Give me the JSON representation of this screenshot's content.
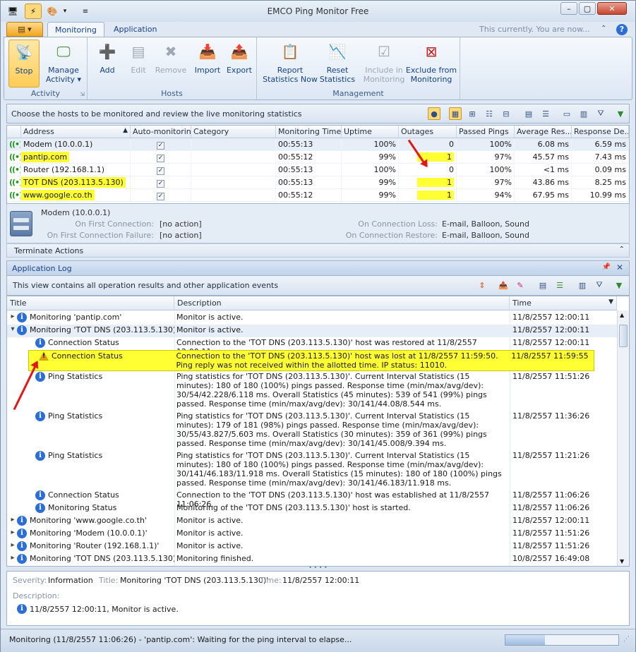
{
  "window": {
    "title": "EMCO Ping Monitor Free"
  },
  "qat_icons": [
    "app-icon",
    "toggle-icon",
    "chart-icon"
  ],
  "tabs": {
    "file": "",
    "monitoring": "Monitoring",
    "application": "Application"
  },
  "tab_right_text": "This currently. You are now...",
  "ribbon": {
    "activity": {
      "label": "Activity",
      "stop": "Stop",
      "manage": "Manage Activity ▾"
    },
    "hosts": {
      "label": "Hosts",
      "add": "Add",
      "edit": "Edit",
      "remove": "Remove",
      "import": "Import",
      "export": "Export"
    },
    "management": {
      "label": "Management",
      "report": "Report Statistics Now",
      "reset": "Reset Statistics",
      "include": "Include in Monitoring",
      "exclude": "Exclude from Monitoring"
    }
  },
  "hosts_panel": {
    "hint": "Choose the hosts to be monitored and review the live monitoring statistics"
  },
  "grid": {
    "columns": [
      "Address",
      "Auto-monitoring",
      "Category",
      "Monitoring Time",
      "Uptime",
      "Outages",
      "Passed Pings",
      "Average Res...",
      "Response De..."
    ],
    "rows": [
      {
        "address": "Modem (10.0.0.1)",
        "auto": "✓",
        "category": "",
        "time": "00:55:13",
        "uptime": "100%",
        "outages": "0",
        "passed": "100%",
        "avg": "6.08 ms",
        "dev": "6.59 ms"
      },
      {
        "address": "pantip.com",
        "auto": "✓",
        "category": "",
        "time": "00:55:12",
        "uptime": "99%",
        "outages": "1",
        "passed": "97%",
        "avg": "45.57 ms",
        "dev": "7.43 ms"
      },
      {
        "address": "Router (192.168.1.1)",
        "auto": "✓",
        "category": "",
        "time": "00:55:13",
        "uptime": "100%",
        "outages": "0",
        "passed": "100%",
        "avg": "<1 ms",
        "dev": "0.09 ms"
      },
      {
        "address": "TOT DNS (203.113.5.130)",
        "auto": "✓",
        "category": "",
        "time": "00:55:13",
        "uptime": "99%",
        "outages": "1",
        "passed": "97%",
        "avg": "43.86 ms",
        "dev": "8.25 ms"
      },
      {
        "address": "www.google.co.th",
        "auto": "✓",
        "category": "",
        "time": "00:55:12",
        "uptime": "99%",
        "outages": "1",
        "passed": "94%",
        "avg": "67.95 ms",
        "dev": "10.99 ms"
      }
    ]
  },
  "details": {
    "host": "Modem (10.0.0.1)",
    "first_connection_label": "On First Connection:",
    "first_connection": "[no action]",
    "first_failure_label": "On First Connection Failure:",
    "first_failure": "[no action]",
    "loss_label": "On Connection Loss:",
    "loss": "E-mail, Balloon, Sound",
    "restore_label": "On Connection Restore:",
    "restore": "E-mail, Balloon, Sound",
    "terminate": "Terminate Actions"
  },
  "log": {
    "title": "Application Log",
    "hint": "This view contains all operation results and other application events",
    "columns": [
      "Title",
      "Description",
      "Time"
    ],
    "rows": [
      {
        "title": "Monitoring 'pantip.com'",
        "desc": "Monitor is active.",
        "time": "11/8/2557 12:00:11"
      },
      {
        "title": "Monitoring 'TOT DNS (203.113.5.130)'",
        "desc": "Monitor is active.",
        "time": "11/8/2557 12:00:11"
      },
      {
        "title": "Connection Status",
        "desc": "Connection to the 'TOT DNS (203.113.5.130)' host was restored at 11/8/2557 12:00:11.",
        "time": "11/8/2557 12:00:11"
      },
      {
        "title": "Connection Status",
        "desc": "Connection to the 'TOT DNS (203.113.5.130)' host was lost at 11/8/2557 11:59:50. Ping reply was not received within the allotted time. IP status: 11010.",
        "time": "11/8/2557 11:59:55"
      },
      {
        "title": "Ping Statistics",
        "desc": "Ping statistics for 'TOT DNS (203.113.5.130)'. Current Interval Statistics (15 minutes): 180 of 180 (100%) pings passed. Response time (min/max/avg/dev): 30/54/42.228/6.118 ms. Overall Statistics (45 minutes): 539 of 541 (99%) pings passed. Response time (min/max/avg/dev): 30/141/44.08/8.544 ms.",
        "time": "11/8/2557 11:51:26"
      },
      {
        "title": "Ping Statistics",
        "desc": "Ping statistics for 'TOT DNS (203.113.5.130)'. Current Interval Statistics (15 minutes): 179 of 181 (98%) pings passed. Response time (min/max/avg/dev): 30/55/43.827/5.603 ms. Overall Statistics (30 minutes): 359 of 361 (99%) pings passed. Response time (min/max/avg/dev): 30/141/45.008/9.394 ms.",
        "time": "11/8/2557 11:36:26"
      },
      {
        "title": "Ping Statistics",
        "desc": "Ping statistics for 'TOT DNS (203.113.5.130)'. Current Interval Statistics (15 minutes): 180 of 180 (100%) pings passed. Response time (min/max/avg/dev): 30/141/46.183/11.918 ms. Overall Statistics (15 minutes): 180 of 180 (100%) pings passed. Response time (min/max/avg/dev): 30/141/46.183/11.918 ms.",
        "time": "11/8/2557 11:21:26"
      },
      {
        "title": "Connection Status",
        "desc": "Connection to the 'TOT DNS (203.113.5.130)' host was established at 11/8/2557 11:06:26.",
        "time": "11/8/2557 11:06:26"
      },
      {
        "title": "Monitoring Status",
        "desc": "Monitoring of the 'TOT DNS (203.113.5.130)' host is started.",
        "time": "11/8/2557 11:06:26"
      },
      {
        "title": "Monitoring 'www.google.co.th'",
        "desc": "Monitor is active.",
        "time": "11/8/2557 12:00:11"
      },
      {
        "title": "Monitoring 'Modem (10.0.0.1)'",
        "desc": "Monitor is active.",
        "time": "11/8/2557 11:51:26"
      },
      {
        "title": "Monitoring 'Router (192.168.1.1)'",
        "desc": "Monitor is active.",
        "time": "11/8/2557 11:51:26"
      },
      {
        "title": "Monitoring 'TOT DNS (203.113.5.130)'",
        "desc": "Monitoring finished.",
        "time": "10/8/2557 16:49:08"
      }
    ]
  },
  "detail_panel": {
    "severity_label": "Severity:",
    "severity": "Information",
    "title_label": "Title:",
    "title": "Monitoring 'TOT DNS (203.113.5.130)'",
    "time_label": "Time:",
    "time": "11/8/2557 12:00:11",
    "description_label": "Description:",
    "description": "11/8/2557 12:00:11,   Monitor is active."
  },
  "status": {
    "text": "Monitoring (11/8/2557 11:06:26) - 'pantip.com': Waiting for the ping interval to elapse..."
  },
  "colors": {
    "highlight": "#ffff33",
    "accent": "#15428b",
    "arrow": "#e01818",
    "signal": "#1d9a1d"
  }
}
